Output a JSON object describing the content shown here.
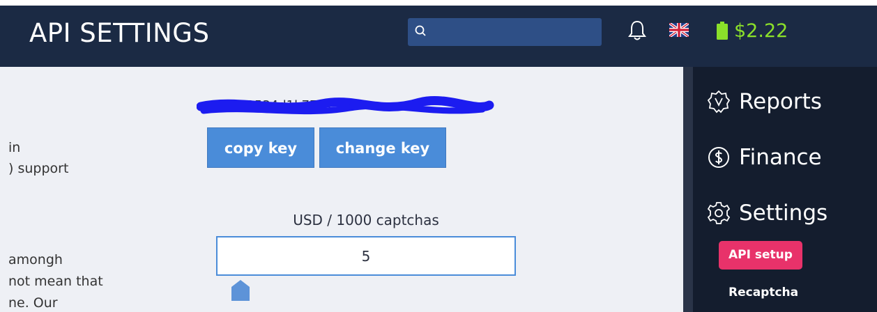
{
  "header": {
    "title": "API SETTINGS",
    "search": {
      "value": "",
      "placeholder": ""
    },
    "balance": "$2.22",
    "icons": {
      "search": "search-icon",
      "notifications": "bell-icon",
      "language": "uk-flag-icon",
      "wallet": "battery-icon"
    },
    "colors": {
      "bar": "#1b2a44",
      "search": "#2e4f86",
      "balance": "#8be02a"
    }
  },
  "main": {
    "description_lines": [
      "in",
      ") support",
      "amongh",
      "not mean that",
      "ne. Our"
    ],
    "api_key": {
      "partial_text": "b9534d1k77e134c",
      "redacted": true,
      "copy_label": "copy key",
      "change_label": "change key"
    },
    "price": {
      "label": "USD / 1000 captchas",
      "value": "5"
    },
    "colors": {
      "accent": "#4a8cd9",
      "background": "#eef0f5"
    }
  },
  "sidebar": {
    "items": [
      {
        "label": "Reports",
        "icon": "reports-badge-icon"
      },
      {
        "label": "Finance",
        "icon": "dollar-circle-icon"
      },
      {
        "label": "Settings",
        "icon": "gear-icon"
      }
    ],
    "subitems": [
      {
        "label": "API setup",
        "active": true
      },
      {
        "label": "Recaptcha",
        "active": false
      }
    ],
    "colors": {
      "background": "#141d2e",
      "active": "#e8326a"
    }
  }
}
